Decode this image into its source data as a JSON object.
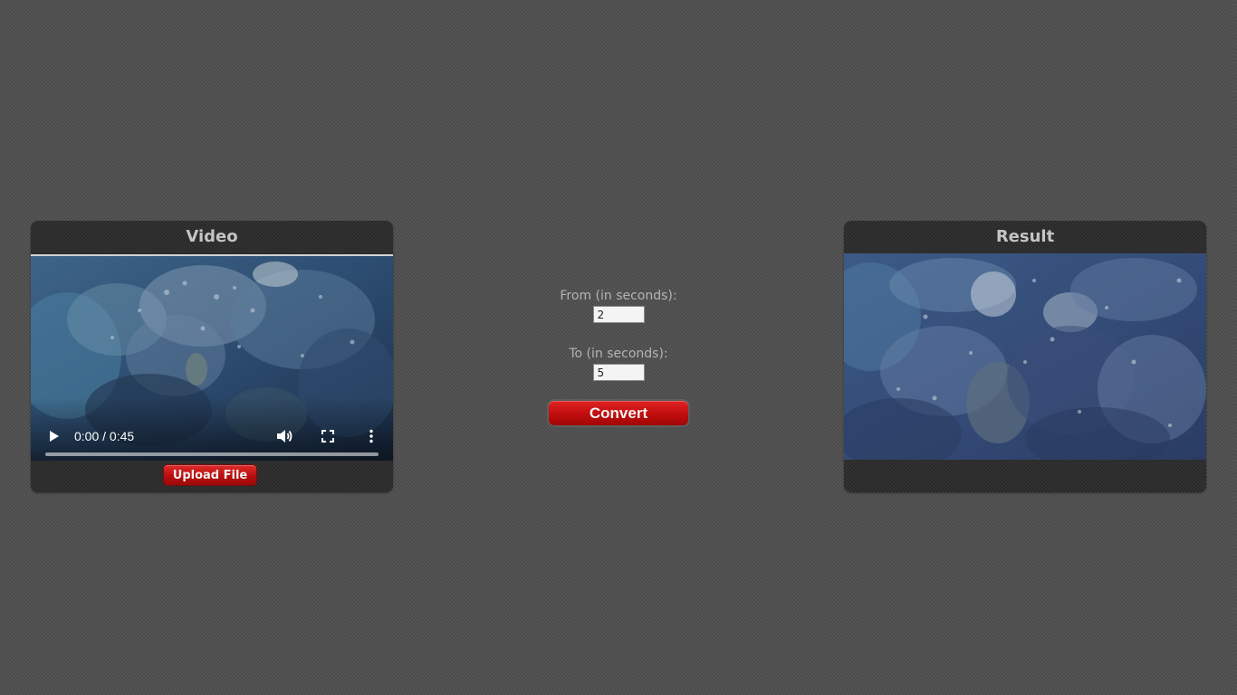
{
  "video_panel": {
    "title": "Video",
    "player": {
      "time_display": "0:00 / 0:45",
      "progress_fraction": 0,
      "play_icon": "play-icon",
      "volume_icon": "volume-icon",
      "fullscreen_icon": "fullscreen-icon",
      "more_icon": "more-options-icon"
    },
    "upload_label": "Upload File"
  },
  "form": {
    "from_label": "From (in seconds):",
    "from_value": "2",
    "to_label": "To (in seconds):",
    "to_value": "5",
    "convert_label": "Convert"
  },
  "result_panel": {
    "title": "Result"
  },
  "colors": {
    "background": "#555555",
    "panel": "#2a2a2a",
    "accent_red": "#c00d0d",
    "label_gray": "#b4b4b4"
  }
}
